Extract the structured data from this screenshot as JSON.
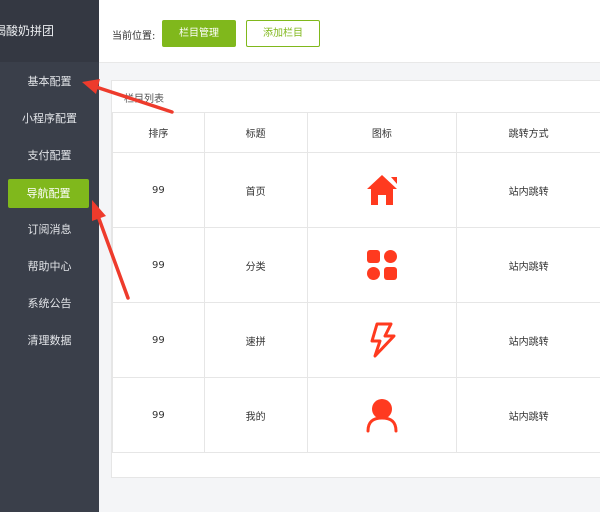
{
  "sidebar": {
    "brand": "喝酸奶拼团",
    "items": [
      {
        "label": "基本配置"
      },
      {
        "label": "小程序配置"
      },
      {
        "label": "支付配置"
      },
      {
        "label": "导航配置"
      },
      {
        "label": "订阅消息"
      },
      {
        "label": "帮助中心"
      },
      {
        "label": "系统公告"
      },
      {
        "label": "清理数据"
      }
    ]
  },
  "topbar": {
    "crumb": "当前位置:",
    "primary_label": "栏目管理",
    "secondary_label": "添加栏目"
  },
  "panel": {
    "title": "栏目列表",
    "headers": [
      "排序",
      "标题",
      "图标",
      "跳转方式"
    ],
    "rows": [
      {
        "sort": "99",
        "title": "首页",
        "icon": "home-icon",
        "jump": "站内跳转"
      },
      {
        "sort": "99",
        "title": "分类",
        "icon": "category-icon",
        "jump": "站内跳转"
      },
      {
        "sort": "99",
        "title": "速拼",
        "icon": "lightning-icon",
        "jump": "站内跳转"
      },
      {
        "sort": "99",
        "title": "我的",
        "icon": "user-icon",
        "jump": "站内跳转"
      }
    ]
  },
  "colors": {
    "sidebar_bg": "#3a3f4a",
    "accent_green": "#80b81c",
    "icon_red": "#ff3a1f",
    "arrow_red": "#ee3b2c"
  }
}
